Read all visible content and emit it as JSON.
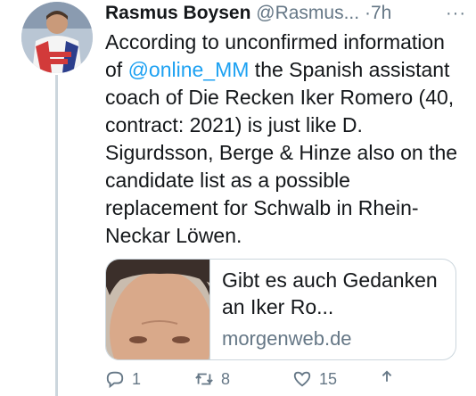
{
  "tweet": {
    "author_name": "Rasmus Boysen",
    "author_handle": "@Rasmus...",
    "separator": "·",
    "time": "7h",
    "more_label": "···",
    "text_before_mention": "According to unconfirmed information of ",
    "mention": "@online_MM",
    "text_after_mention": " the Spanish assistant coach of Die Recken Iker Romero (40, contract: 2021) is just like D. Sigurdsson, Berge & Hinze also on the candidate list as a possible replacement for Schwalb in Rhein-Neckar Löwen."
  },
  "card": {
    "title": "Gibt es auch Gedanken an Iker Ro...",
    "domain": "morgenweb.de"
  },
  "actions": {
    "reply_count": "1",
    "retweet_count": "8",
    "like_count": "15"
  },
  "colors": {
    "link": "#1da1f2",
    "secondary_text": "#657786",
    "border": "#ccd6dd"
  }
}
